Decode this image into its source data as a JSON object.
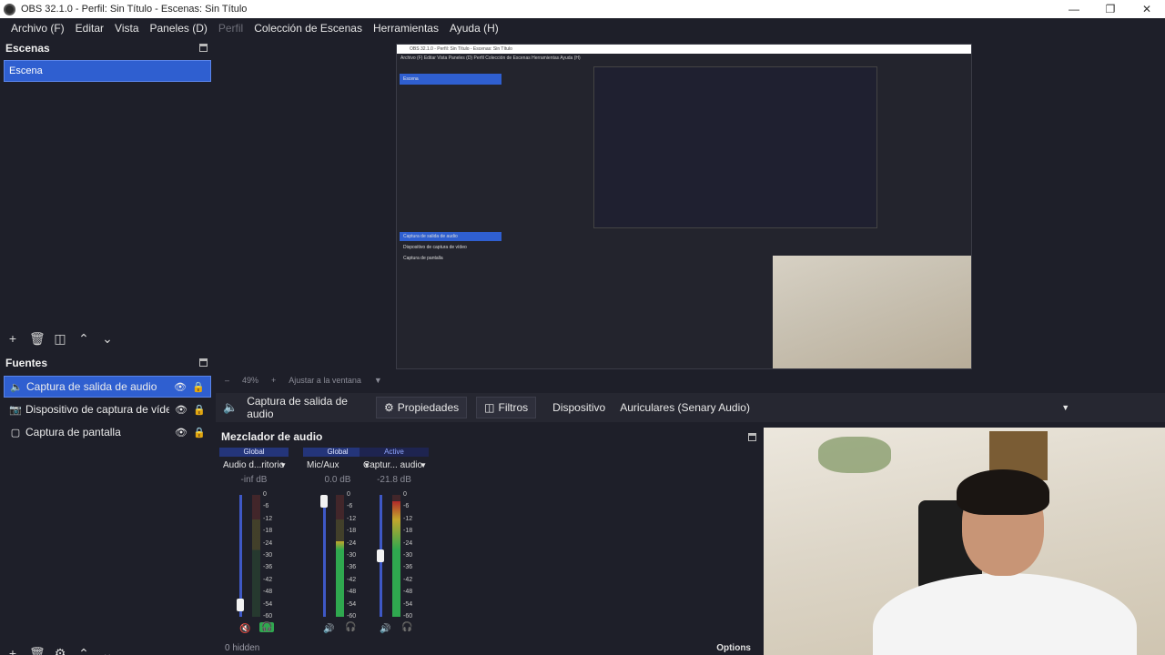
{
  "window": {
    "title": "OBS 32.1.0 - Perfil: Sin Título - Escenas: Sin Título"
  },
  "menu": [
    {
      "label": "Archivo (F)",
      "disabled": false
    },
    {
      "label": "Editar",
      "disabled": false
    },
    {
      "label": "Vista",
      "disabled": false
    },
    {
      "label": "Paneles (D)",
      "disabled": false
    },
    {
      "label": "Perfil",
      "disabled": true
    },
    {
      "label": "Colección de Escenas",
      "disabled": false
    },
    {
      "label": "Herramientas",
      "disabled": false
    },
    {
      "label": "Ayuda (H)",
      "disabled": false
    }
  ],
  "scenes": {
    "title": "Escenas",
    "items": [
      "Escena"
    ]
  },
  "sources": {
    "title": "Fuentes",
    "items": [
      {
        "label": "Captura de salida de audio",
        "icon": "speaker-icon",
        "selected": true
      },
      {
        "label": "Dispositivo de captura de vídeo",
        "icon": "camera-icon",
        "selected": false
      },
      {
        "label": "Captura de pantalla",
        "icon": "monitor-icon",
        "selected": false
      }
    ]
  },
  "preview": {
    "zoom": "49%",
    "fit_label": "Ajustar a la ventana",
    "nested": {
      "title": "OBS 32.1.0 - Perfil: Sin Título - Escenas: Sin Título",
      "menu": "Archivo (F)   Editar   Vista   Paneles (D)   Perfil   Colección de Escenas   Herramientas   Ayuda (H)",
      "scene": "Escena",
      "sources": [
        "Captura de salida de audio",
        "Dispositivo de captura de vídeo",
        "Captura de pantalla"
      ]
    }
  },
  "properties_bar": {
    "source_name": "Captura de salida de audio",
    "properties_label": "Propiedades",
    "filters_label": "Filtros",
    "device_label": "Dispositivo",
    "device_value": "Auriculares (Senary Audio)"
  },
  "mixer": {
    "title": "Mezclador de audio",
    "scale": [
      "0",
      "-6",
      "-12",
      "-18",
      "-24",
      "-30",
      "-36",
      "-42",
      "-48",
      "-54",
      "-60"
    ],
    "strips": [
      {
        "tag": "Global",
        "name": "Audio d...ritorio",
        "db": "-inf dB",
        "level": 0.0,
        "volume": 0.05
      },
      {
        "tag": "Global",
        "name": "Mic/Aux",
        "db": "0.0 dB",
        "level": 0.62,
        "volume": 1.0
      },
      {
        "tag": "Active",
        "name": "Captur... audio",
        "db": "-21.8 dB",
        "level": 0.95,
        "volume": 0.5
      }
    ],
    "hidden_count": "0 hidden",
    "options_label": "Options"
  },
  "colors": {
    "accent": "#2f5fd0",
    "background": "#1e1f29",
    "meter_green": "#2fa84f",
    "meter_yellow": "#c2a62c",
    "meter_red": "#b02a2a"
  }
}
